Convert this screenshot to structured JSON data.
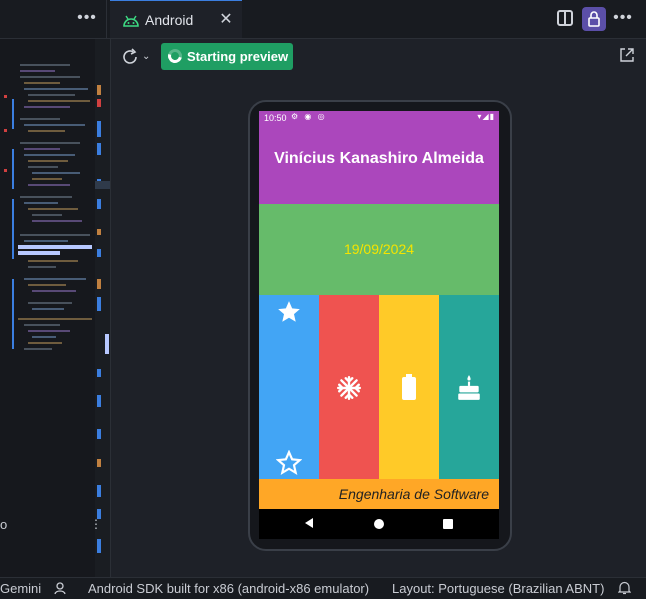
{
  "tab": {
    "label": "Android"
  },
  "toolbar": {
    "preview_label": "Starting preview"
  },
  "code_panel": {
    "stray_text": "o",
    "dots": "⋮"
  },
  "app": {
    "statusbar_time": "10:50",
    "name": "Vinícius Kanashiro Almeida",
    "date": "19/09/2024",
    "course": "Engenharia de Software",
    "colors": {
      "purple": "#ab47bc",
      "green": "#66bb6a",
      "blue": "#42a5f5",
      "red": "#ef5350",
      "yellow": "#ffca28",
      "teal": "#26a69a",
      "orange": "#ffa726",
      "date_text": "#f5e400"
    },
    "icons": [
      "star-icon",
      "star-outline-icon",
      "snowflake-icon",
      "battery-icon",
      "cake-icon"
    ]
  },
  "statusbar": {
    "gemini": "Gemini",
    "device": "Android SDK built for x86 (android-x86 emulator)",
    "layout": "Layout: Portuguese (Brazilian ABNT)"
  }
}
